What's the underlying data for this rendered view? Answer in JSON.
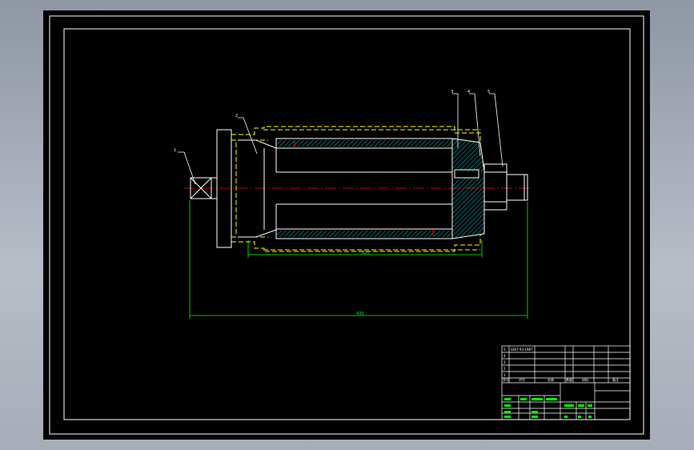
{
  "drawing": {
    "background": "#000000",
    "colors": {
      "frame": "#ffffff",
      "outline": "#ffffff",
      "hidden": "#ffff00",
      "centerline": "#ff0000",
      "dimension": "#00ff00",
      "hatch": "#00ffff",
      "leader": "#ffffff"
    },
    "part_labels": [
      "1",
      "2",
      "3",
      "4",
      "5"
    ],
    "dimensions": {
      "inner_length": "220",
      "overall_length": "430"
    },
    "title_block": {
      "rows": [
        [
          "5",
          "GB/T 93-1987",
          "",
          "",
          "",
          ""
        ],
        [
          "4",
          "",
          "",
          "",
          "",
          ""
        ],
        [
          "3",
          "",
          "",
          "",
          "",
          ""
        ],
        [
          "2",
          "",
          "",
          "",
          "",
          ""
        ],
        [
          "1",
          "",
          "",
          "",
          "",
          ""
        ]
      ],
      "header": [
        "序号",
        "代号",
        "名称",
        "数量",
        "材料",
        "备注"
      ]
    }
  }
}
